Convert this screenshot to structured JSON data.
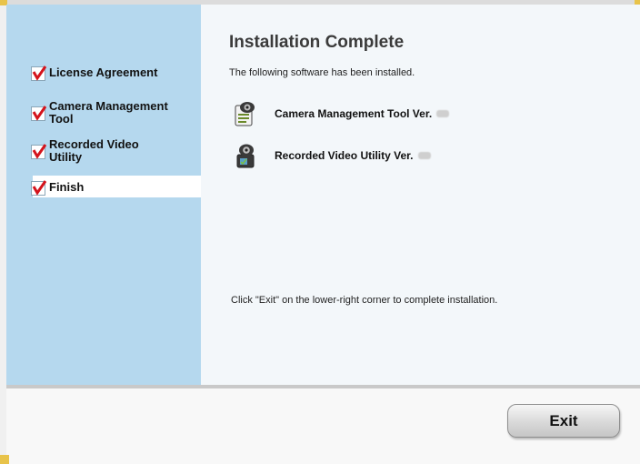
{
  "sidebar": {
    "steps": [
      {
        "label": "License Agreement"
      },
      {
        "label": "Camera Management Tool"
      },
      {
        "label": "Recorded Video Utility"
      },
      {
        "label": "Finish"
      }
    ]
  },
  "main": {
    "title": "Installation Complete",
    "subtitle": "The following software has been installed.",
    "software": [
      {
        "name": "Camera Management Tool Ver.",
        "icon": "camera-tool-icon"
      },
      {
        "name": "Recorded Video Utility Ver.",
        "icon": "video-utility-icon"
      }
    ],
    "hint": "Click \"Exit\" on the lower-right corner to complete installation."
  },
  "footer": {
    "exit_label": "Exit"
  },
  "colors": {
    "sidebar_bg": "#b5d8ee",
    "check_red": "#d4141c"
  }
}
